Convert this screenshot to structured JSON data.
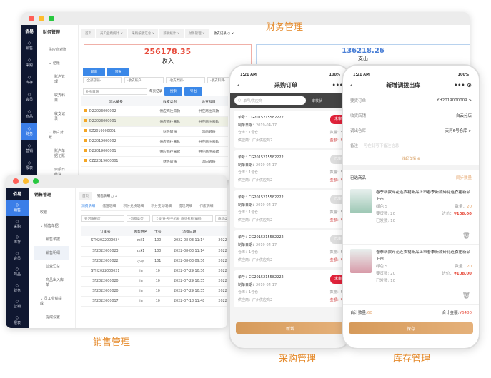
{
  "labels": {
    "finance": "财务管理",
    "sales": "销售管理",
    "purchase": "采购管理",
    "stock": "库存管理"
  },
  "colors": {
    "accent": "#3b88e8",
    "sidebar": "#0f1730",
    "orange": "#e58a2b",
    "income": "#e74c3c",
    "expense": "#4a7fd6",
    "gold": "#d69a5a"
  },
  "brand": "佰易",
  "nav": [
    {
      "icon": "user-icon",
      "label": "销售"
    },
    {
      "icon": "cart-icon",
      "label": "采购"
    },
    {
      "icon": "warehouse-icon",
      "label": "库存"
    },
    {
      "icon": "member-icon",
      "label": "会员"
    },
    {
      "icon": "goods-icon",
      "label": "商品"
    },
    {
      "icon": "finance-icon",
      "label": "财务"
    },
    {
      "icon": "marketing-icon",
      "label": "营销"
    },
    {
      "icon": "report-icon",
      "label": "报表"
    }
  ],
  "finance": {
    "menu_title": "财务管理",
    "menu": [
      {
        "t": "供应商对账",
        "c": ""
      },
      {
        "t": "⌄ 记账",
        "c": "h2"
      },
      {
        "t": "账户管理",
        "c": "sub"
      },
      {
        "t": "收支科目",
        "c": "sub"
      },
      {
        "t": "收支记录",
        "c": "sub"
      },
      {
        "t": "⌄ 账户对账",
        "c": "h2"
      },
      {
        "t": "账户单据记账",
        "c": "sub"
      },
      {
        "t": "余额日结算",
        "c": "sub"
      }
    ],
    "tabs": [
      "首页",
      "员工业绩统计 ×",
      "采购按收汇总 ×",
      "薪酬统计 ×",
      "财务管理 ×",
      "收支记录 ○ ×"
    ],
    "income_value": "256178.35",
    "income_label": "收入",
    "expense_value": "136218.26",
    "expense_label": "支出",
    "buttons": [
      "新增",
      "转账"
    ],
    "filters": [
      "-全部店铺-",
      "-收支账户-",
      "-收支类别-",
      "-收支科目-"
    ],
    "date_label": "业务日期",
    "page_size": "每页记录",
    "search": "搜索",
    "export": "导出",
    "columns": [
      "流水编号",
      "收支类别",
      "收支科目"
    ],
    "rows": [
      [
        "DZ2023000002",
        "供应商往来款",
        "供应商往来款"
      ],
      [
        "DZ2023000001",
        "供应商往来款",
        "供应商往来款"
      ],
      [
        "SZ2019000001",
        "财务转账",
        "流向转账"
      ],
      [
        "DZ2019000002",
        "供应商往来款",
        "供应商往来款"
      ],
      [
        "DZ2019000001",
        "供应商往来款",
        "供应商往来款"
      ],
      [
        "CZZ2019000001",
        "财务转账",
        "流向转账"
      ]
    ]
  },
  "sales": {
    "menu_title": "销售管理",
    "menu": [
      {
        "t": "收银",
        "c": ""
      },
      {
        "t": "⌄ 销售单据",
        "c": "h2"
      },
      {
        "t": "销售单据",
        "c": "sub"
      },
      {
        "t": "销售明细",
        "c": "sub sel"
      },
      {
        "t": "营业汇总",
        "c": "sub"
      },
      {
        "t": "商品出入库单",
        "c": "sub"
      },
      {
        "t": "⌄ 员工业绩提成",
        "c": "h2"
      },
      {
        "t": "提成设置",
        "c": "sub"
      },
      {
        "t": "员工提成汇总",
        "c": "sub"
      },
      {
        "t": "员工业绩统计",
        "c": "sub"
      }
    ],
    "tabs": [
      "首页",
      "销售明细 ○ ×"
    ],
    "subtabs": [
      "消费明细",
      "储值明细",
      "积分兑换明细",
      "积分变动明细",
      "提现明细",
      "作废明细"
    ],
    "store": "天河旗舰店",
    "type": "-消费类型-",
    "search_placeholder": "卡号/姓名/手机号 商品名称/编码",
    "goods_placeholder": "商品类别",
    "columns": [
      "订单号",
      "顾客姓名",
      "卡号",
      "消费日期",
      ""
    ],
    "rows": [
      [
        "STH2022000024",
        "zkk1",
        "100",
        "2022-08-03 11:14",
        "2022-"
      ],
      [
        "SF2022000023",
        "zkk1",
        "100",
        "2022-08-03 11:14",
        "2022-"
      ],
      [
        "SF2022000022",
        "小小",
        "101",
        "2022-08-03 09:36",
        "2022-"
      ],
      [
        "STH2022000021",
        "lin",
        "10",
        "2022-07-29 10:36",
        "2022-"
      ],
      [
        "SF2022000020",
        "lin",
        "10",
        "2022-07-29 10:35",
        "2022-"
      ],
      [
        "SF2022000020",
        "lin",
        "10",
        "2022-07-29 10:35",
        "2022-"
      ],
      [
        "SF2022000017",
        "lin",
        "10",
        "2022-07-18 11:48",
        "2022-"
      ]
    ]
  },
  "purchase": {
    "time": "1:21 AM",
    "battery": "100%",
    "title": "采购订单",
    "search_placeholder": "单号/供应商",
    "filter": "审核状",
    "orders": [
      {
        "no": "单号：CG2015215582222",
        "date_label": "制单日期：",
        "date": "2019-04-17",
        "wh": "仓库：1号仓",
        "sup": "供应商：广州供应商2",
        "qty": "数量：50",
        "amt": "金额：¥0",
        "status": "未审核",
        "red": true
      },
      {
        "no": "单号：CG2015215582222",
        "date_label": "制单日期：",
        "date": "2019-04-17",
        "wh": "仓库：1号仓",
        "sup": "供应商：广州供应商2",
        "qty": "数量：50",
        "amt": "金额：¥0",
        "status": "已审核",
        "red": false
      },
      {
        "no": "单号：CG2015215582222",
        "date_label": "制单日期：",
        "date": "2019-04-17",
        "wh": "仓库：1号仓",
        "sup": "供应商：广州供应商2",
        "qty": "数量：50",
        "amt": "金额：¥0",
        "status": "已审核",
        "red": false
      },
      {
        "no": "单号：CG2015215582222",
        "date_label": "制单日期：",
        "date": "2019-04-17",
        "wh": "仓库：1号仓",
        "sup": "供应商：广州供应商2",
        "qty": "数量：50",
        "amt": "金额：¥0",
        "status": "已审核",
        "red": false
      },
      {
        "no": "单号：CG2015215582222",
        "date_label": "制单日期：",
        "date": "2019-04-17",
        "wh": "仓库：1号仓",
        "sup": "供应商：广州供应商2",
        "qty": "数量：50",
        "amt": "金额：¥0",
        "status": "未审核",
        "red": true
      }
    ],
    "add": "新增"
  },
  "stock": {
    "time": "1:21 AM",
    "battery": "100%",
    "title": "新增调拨出库",
    "fields": [
      {
        "l": "要货订单",
        "v": "YH2019000009 >"
      },
      {
        "l": "收货店铺",
        "v": "白云分店"
      },
      {
        "l": "调出仓库",
        "v": "天河6号仓库 >"
      }
    ],
    "remark_label": "备注",
    "remark_placeholder": "可在此写下备注信息",
    "collapse": "收起详情",
    "selected": "已选商品：",
    "sync": "同步数量",
    "goods": [
      {
        "name": "春季新款碎花连衣裙新品上市春季新款碎花连衣裙新品上市",
        "spec": "绿色  S",
        "req": "要货数: 20",
        "sent": "已发数: 10",
        "qty_l": "数量：",
        "qty": "20",
        "price_l": "进价：",
        "price": "¥108.00",
        "color": "#9cc7b4"
      },
      {
        "name": "春季新款碎花连衣裙新品上市春季新款碎花连衣裙新品上市",
        "spec": "绿色  S",
        "req": "要货数: 20",
        "sent": "已发数: 10",
        "qty_l": "数量：",
        "qty": "20",
        "price_l": "进价：",
        "price": "¥108.00",
        "color": "#d89aa8"
      }
    ],
    "total_qty_l": "合计数量:",
    "total_qty": "60",
    "total_amt_l": "合计金额:",
    "total_amt": "¥6480",
    "save": "保存"
  }
}
